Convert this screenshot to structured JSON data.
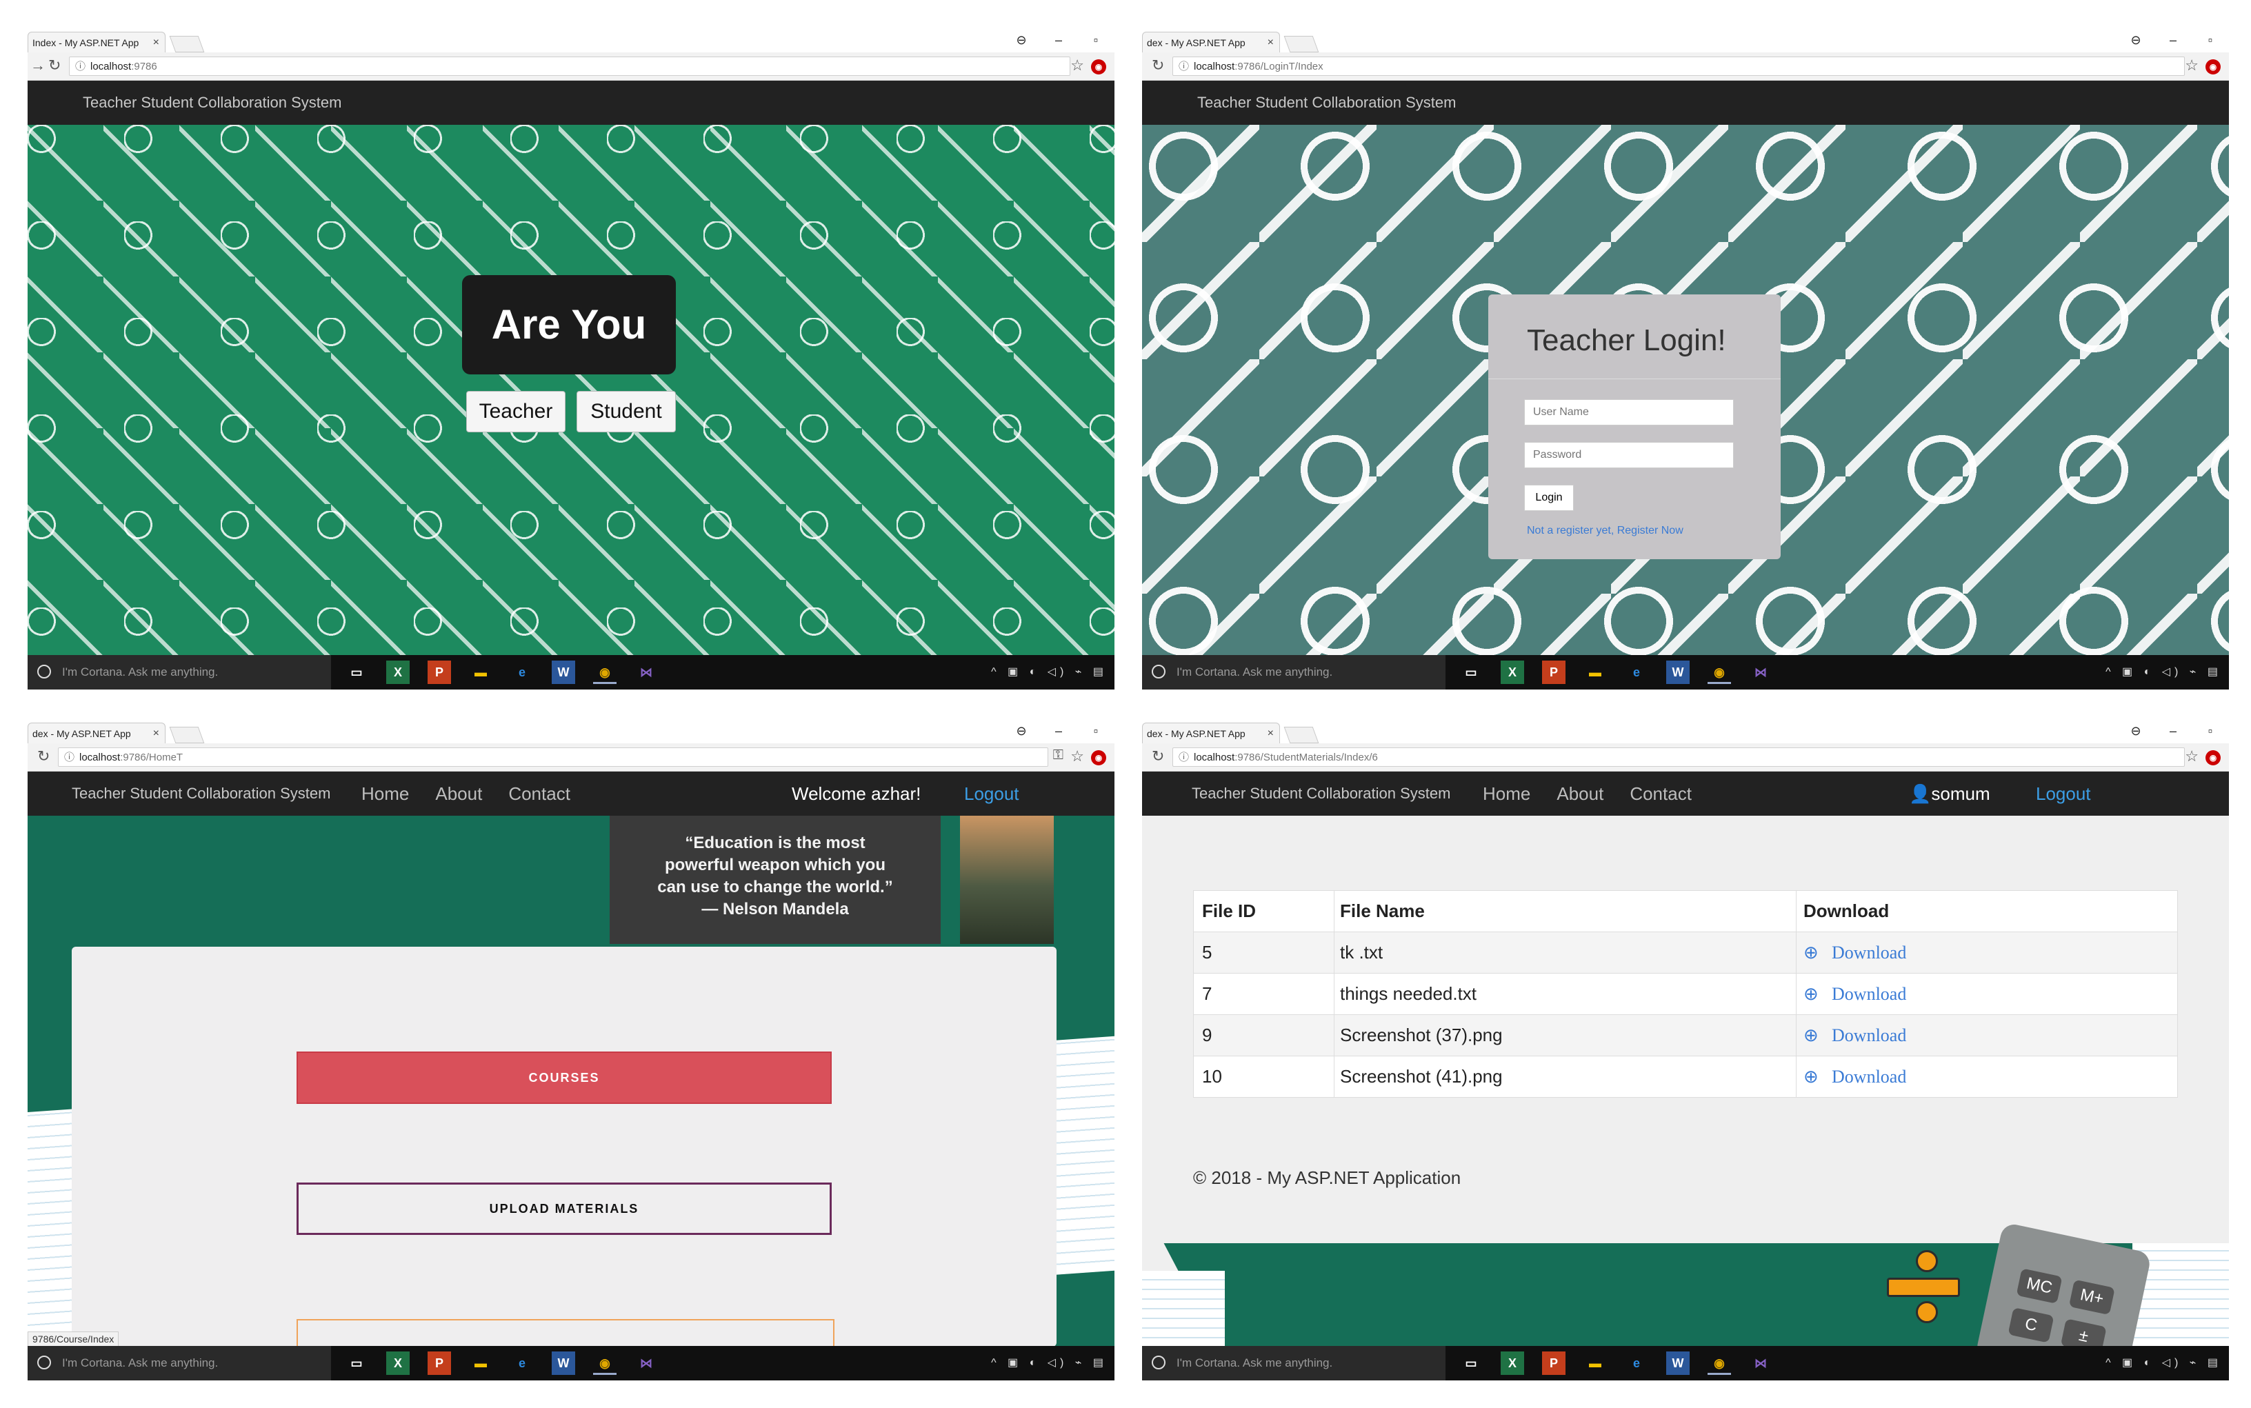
{
  "taskbar": {
    "cortana_text": "I'm Cortana. Ask me anything."
  },
  "win1": {
    "tab_title": "Index - My ASP.NET App",
    "url_host": "localhost",
    "url_path": ":9786",
    "brand": "Teacher Student Collaboration System",
    "heading": "Are You",
    "teacher_button": "Teacher",
    "student_button": "Student"
  },
  "win2": {
    "tab_title": "dex - My ASP.NET App",
    "url_host": "localhost",
    "url_path": ":9786/LoginT/Index",
    "brand": "Teacher Student Collaboration System",
    "login_title": "Teacher Login!",
    "username_placeholder": "User Name",
    "password_placeholder": "Password",
    "login_button": "Login",
    "register_link": "Not a register yet, Register Now"
  },
  "win3": {
    "tab_title": "dex - My ASP.NET App",
    "url_host": "localhost",
    "url_path": ":9786/HomeT",
    "brand": "Teacher Student Collaboration System",
    "nav": [
      "Home",
      "About",
      "Contact"
    ],
    "welcome": "Welcome azhar!",
    "logout": "Logout",
    "quote_line1": "“Education is the most",
    "quote_line2": "powerful weapon which you",
    "quote_line3": "can use to change the world.”",
    "quote_author": "— Nelson Mandela",
    "courses_button": "COURSES",
    "upload_button": "UPLOAD MATERIALS",
    "status_url": "9786/Course/Index"
  },
  "win4": {
    "tab_title": "dex - My ASP.NET App",
    "url_host": "localhost",
    "url_path": ":9786/StudentMaterials/Index/6",
    "brand": "Teacher Student Collaboration System",
    "nav": [
      "Home",
      "About",
      "Contact"
    ],
    "user": "somum",
    "logout": "Logout",
    "table_headers": [
      "File ID",
      "File Name",
      "Download"
    ],
    "rows": [
      {
        "id": "5",
        "name": "tk .txt",
        "action": "Download"
      },
      {
        "id": "7",
        "name": "things needed.txt",
        "action": "Download"
      },
      {
        "id": "9",
        "name": "Screenshot (37).png",
        "action": "Download"
      },
      {
        "id": "10",
        "name": "Screenshot (41).png",
        "action": "Download"
      }
    ],
    "footer": "© 2018 - My ASP.NET Application",
    "calc_keys": [
      "MC",
      "M+",
      "C",
      "±"
    ]
  },
  "colors": {
    "chalkboard_green": "#1d8a5f",
    "teal_bg": "#4d7f7b",
    "navbar": "#222222",
    "logout_blue": "#3c9ee5",
    "courses_red": "#d9505a",
    "upload_border": "#6b2a5b",
    "link_blue": "#3a7bd5"
  }
}
